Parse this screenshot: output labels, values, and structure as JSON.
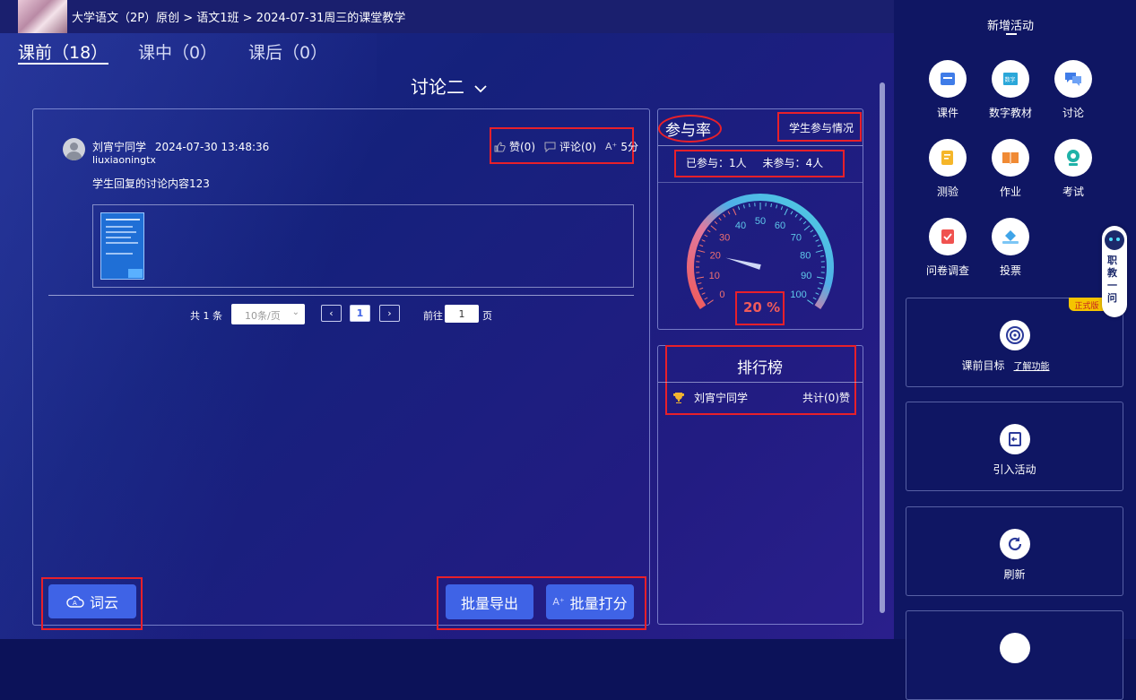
{
  "breadcrumb": {
    "text": "大学语文（2P）原创 > 语文1班 > 2024-07-31周三的课堂教学"
  },
  "tabs": [
    {
      "label": "课前（18）"
    },
    {
      "label": "课中（0）"
    },
    {
      "label": "课后（0）"
    }
  ],
  "discussion": {
    "title": "讨论二"
  },
  "post": {
    "author": "刘宵宁同学",
    "time": "2024-07-30 13:48:36",
    "username": "liuxiaoningtx",
    "content": "学生回复的讨论内容123",
    "likes": "赞(0)",
    "comments": "评论(0)",
    "score": "5分"
  },
  "pagination": {
    "total": "共 1 条",
    "page_size": "10条/页",
    "current": "1",
    "goto_label": "前往",
    "goto_value": "1",
    "page_suffix": "页"
  },
  "buttons": {
    "wordcloud": "词云",
    "batch_export": "批量导出",
    "batch_score": "批量打分"
  },
  "participation": {
    "title": "参与率",
    "link": "学生参与情况",
    "joined": "已参与：1人",
    "not_joined": "未参与：4人",
    "rate_text": "20 %",
    "rate": 20,
    "gauge_ticks": [
      "0",
      "10",
      "20",
      "30",
      "40",
      "50",
      "60",
      "70",
      "80",
      "90",
      "100"
    ]
  },
  "ranking": {
    "title": "排行榜",
    "items": [
      {
        "name": "刘宵宁同学",
        "count": "共计(0)赞"
      }
    ]
  },
  "sidebar": {
    "header": "新增活动",
    "activities": [
      {
        "label": "课件",
        "icon": "courseware-icon"
      },
      {
        "label": "数字教材",
        "icon": "textbook-icon"
      },
      {
        "label": "讨论",
        "icon": "discussion-icon"
      },
      {
        "label": "测验",
        "icon": "quiz-icon"
      },
      {
        "label": "作业",
        "icon": "homework-icon"
      },
      {
        "label": "考试",
        "icon": "exam-icon"
      },
      {
        "label": "问卷调查",
        "icon": "survey-icon"
      },
      {
        "label": "投票",
        "icon": "vote-icon"
      }
    ],
    "cards": [
      {
        "label": "课前目标",
        "link": "了解功能",
        "badge": "正式版"
      },
      {
        "label": "引入活动"
      },
      {
        "label": "刷新"
      }
    ],
    "assistant": {
      "label": "职教一问"
    }
  },
  "colors": {
    "accent": "#3f63e6",
    "highlight": "#e8202a",
    "gauge_cold": "#4fc2e8",
    "gauge_warm": "#f05a5a"
  }
}
